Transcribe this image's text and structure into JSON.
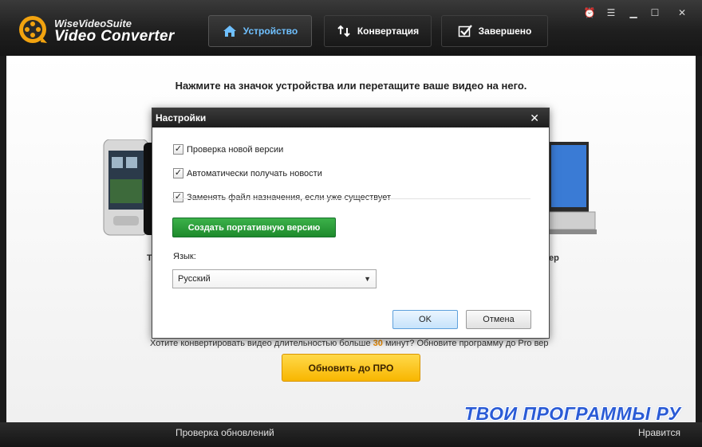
{
  "app": {
    "brand_small": "WiseVideoSuite",
    "brand_big": "Video Converter",
    "logo_icon": "film-reel-logo-icon"
  },
  "tabs": [
    {
      "label": "Устройство",
      "icon": "house-icon",
      "active": true
    },
    {
      "label": "Конвертация",
      "icon": "swap-arrows-icon",
      "active": false
    },
    {
      "label": "Завершено",
      "icon": "checkmark-icon",
      "active": false
    }
  ],
  "window_controls": [
    "alarm-icon",
    "menu-icon",
    "minimize-icon",
    "maximize-icon",
    "close-icon"
  ],
  "main": {
    "instruction": "Нажмите на значок устройства или перетащите ваше видео на него.",
    "peek_left": "Т",
    "peek_right": "ер",
    "promo_before": "Хотите конвертировать видео длительностью больше",
    "promo_minutes": "30",
    "promo_after": "минут? Обновите программу до Pro вер",
    "upgrade_button": "Обновить до ПРО"
  },
  "dialog": {
    "title": "Настройки",
    "checkboxes": [
      {
        "label": "Проверка новой версии",
        "checked": true
      },
      {
        "label": "Автоматически получать новости",
        "checked": true
      },
      {
        "label": "Заменять файл назначения, если уже существует",
        "checked": true
      }
    ],
    "portable_button": "Создать портативную версию",
    "language_label": "Язык:",
    "language_value": "Русский",
    "ok_button": "OK",
    "cancel_button": "Отмена"
  },
  "status": {
    "left": "Проверка обновлений",
    "right": "Нравится"
  },
  "watermark": "ТВОИ ПРОГРАММЫ РУ",
  "colors": {
    "accent_blue": "#6fc0ff",
    "green_button": "#2a9d3a",
    "upgrade_yellow": "#f8c000",
    "highlight_orange": "#e88a00"
  }
}
